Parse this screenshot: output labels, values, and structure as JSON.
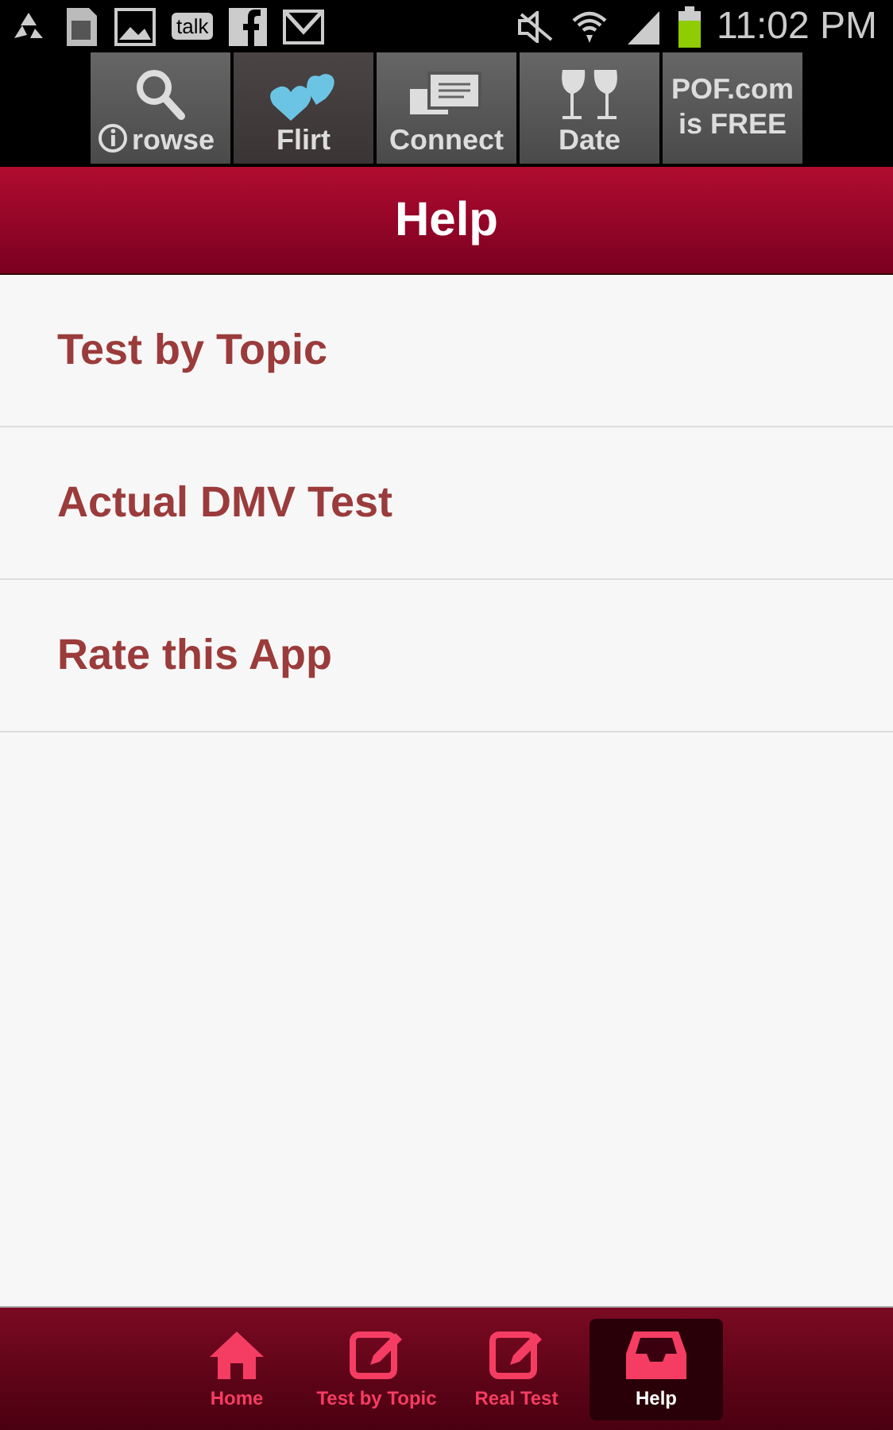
{
  "status_bar": {
    "talk_label": "talk",
    "time": "11:02 PM"
  },
  "ad_banner": {
    "tabs": [
      {
        "label": "rowse",
        "kind": "search",
        "selected": false
      },
      {
        "label": "Flirt",
        "kind": "hearts",
        "selected": true
      },
      {
        "label": "Connect",
        "kind": "messages",
        "selected": false
      },
      {
        "label": "Date",
        "kind": "glasses",
        "selected": false
      },
      {
        "label": "POF.com is FREE",
        "kind": "text",
        "selected": false
      }
    ]
  },
  "header": {
    "title": "Help"
  },
  "menu": [
    {
      "label": "Test by Topic"
    },
    {
      "label": "Actual DMV Test"
    },
    {
      "label": "Rate this App"
    }
  ],
  "bottom_nav": [
    {
      "label": "Home",
      "kind": "home",
      "selected": false
    },
    {
      "label": "Test by Topic",
      "kind": "edit",
      "selected": false
    },
    {
      "label": "Real Test",
      "kind": "edit",
      "selected": false
    },
    {
      "label": "Help",
      "kind": "inbox",
      "selected": true
    }
  ]
}
